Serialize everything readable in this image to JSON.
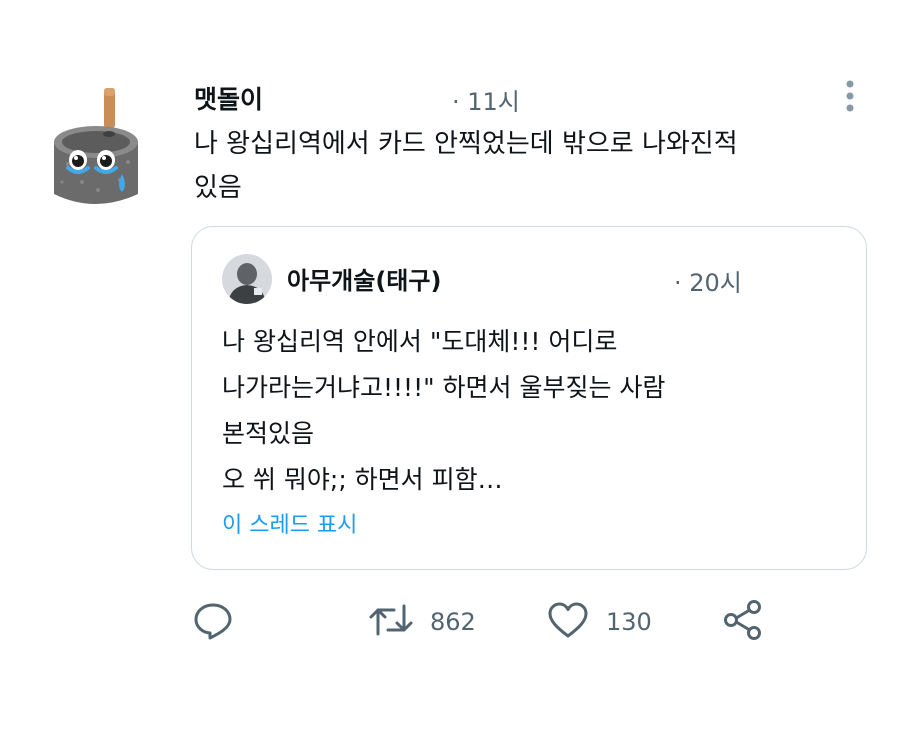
{
  "tweet": {
    "author_name": "맷돌이",
    "time": "· 11시",
    "text_lines": [
      "나 왕십리역에서 카드 안찍었는데 밖으로 나와진적",
      "있음"
    ]
  },
  "quote": {
    "author_name": "아무개술(태구)",
    "time": "· 20시",
    "text_lines": [
      "나 왕십리역 안에서 \"도대체!!! 어디로",
      "나가라는거냐고!!!!\" 하면서 울부짖는 사람",
      "본적있음",
      "오 쒸 뭐야;; 하면서 피함…"
    ],
    "show_thread_label": "이 스레드 표시"
  },
  "actions": {
    "reply_icon": "reply-icon",
    "retweet_icon": "retweet-icon",
    "retweet_count": "862",
    "like_icon": "heart-icon",
    "like_count": "130",
    "share_icon": "share-icon"
  },
  "colors": {
    "text": "#0f1419",
    "secondary": "#536471",
    "link": "#1d9bf0",
    "border": "#cfd9de"
  }
}
